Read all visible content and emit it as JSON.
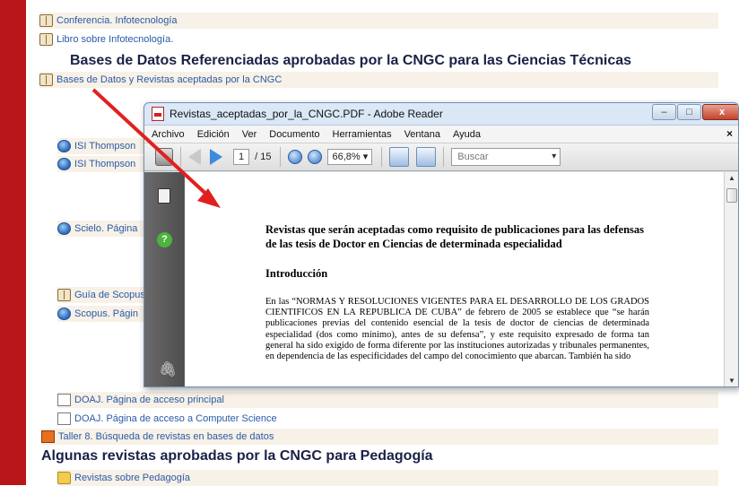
{
  "page": {
    "links_top": [
      {
        "label": "Conferencia. Infotecnología",
        "icon": "book-icon"
      },
      {
        "label": "Libro sobre Infotecnología.",
        "icon": "book-icon"
      }
    ],
    "heading_technical": "Bases de Datos Referenciadas aprobadas por la CNGC para las Ciencias Técnicas",
    "link_bases": "Bases de Datos y Revistas aceptadas por la CNGC",
    "partial_links": [
      {
        "label": "ISI Thompson",
        "icon": "globe-icon"
      },
      {
        "label": "ISI Thompson",
        "icon": "globe-icon"
      },
      {
        "label": "Scielo. Página",
        "icon": "globe-icon"
      },
      {
        "label": "Guía de Scopus",
        "icon": "book-icon"
      },
      {
        "label": "Scopus. Págin",
        "icon": "globe-icon"
      }
    ],
    "links_bottom": [
      {
        "label": "DOAJ. Página de acceso principal",
        "icon": "page-icon"
      },
      {
        "label": "DOAJ. Página de acceso a Computer Science",
        "icon": "page-icon"
      }
    ],
    "workshop_link": "Taller 8. Búsqueda de revistas en bases de datos",
    "heading_pedagogy": "Algunas revistas aprobadas por la CNGC para Pedagogía",
    "pedagogy_folder": "Revistas sobre Pedagogía"
  },
  "reader": {
    "title": "Revistas_aceptadas_por_la_CNGC.PDF - Adobe Reader",
    "window_buttons": {
      "minimize": "–",
      "maximize": "□",
      "close": "x"
    },
    "menu": [
      "Archivo",
      "Edición",
      "Ver",
      "Documento",
      "Herramientas",
      "Ventana",
      "Ayuda"
    ],
    "menu_close": "×",
    "toolbar": {
      "page_current": "1",
      "page_total": "/ 15",
      "zoom": "66,8%",
      "zoom_caret": "▾",
      "search_placeholder": "Buscar"
    },
    "left_panel": {
      "help": "?",
      "attach": "🖇"
    },
    "document": {
      "title": "Revistas que serán aceptadas como requisito de publicaciones para las defensas de las tesis de Doctor en Ciencias de determinada especialidad",
      "section": "Introducción",
      "paragraph": "En las “NORMAS Y RESOLUCIONES VIGENTES PARA EL DESARROLLO DE LOS GRADOS CIENTIFICOS EN LA REPUBLICA DE CUBA” de febrero de 2005 se establece que “se harán publicaciones previas del contenido esencial de la tesis de doctor de ciencias de determinada especialidad (dos como mínimo), antes de su defensa”, y este requisito expresado de forma tan general ha sido exigido de forma diferente por las instituciones autorizadas y tribunales permanentes, en dependencia de las especificidades del campo del conocimiento que abarcan. También ha sido"
    }
  },
  "colors": {
    "sidebar_red": "#b8161b",
    "link_blue": "#2a5aa6",
    "heading_navy": "#1a2145",
    "arrow_red": "#e02020"
  }
}
